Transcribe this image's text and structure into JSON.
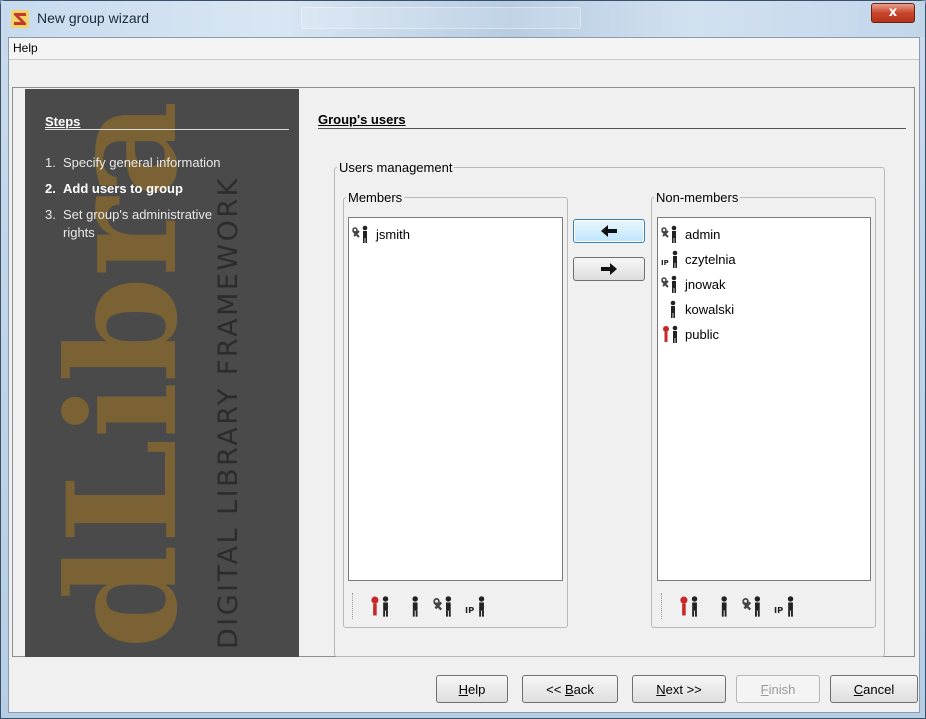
{
  "window": {
    "title": "New group wizard",
    "close_label": "x"
  },
  "menu": {
    "help": "Help"
  },
  "steps": {
    "title": "Steps",
    "items": [
      {
        "num": "1.",
        "label": "Specify general information",
        "active": false
      },
      {
        "num": "2.",
        "label": "Add users to group",
        "active": true
      },
      {
        "num": "3.",
        "label": "Set group's administrative",
        "label2": "rights",
        "active": false
      }
    ],
    "watermark_text": "DIGITAL LIBRARY FRAMEWORK",
    "logo_text": "dLibra"
  },
  "content": {
    "section_title": "Group's users",
    "users_management": "Users management",
    "members_legend": "Members",
    "nonmembers_legend": "Non-members",
    "members": [
      {
        "name": "jsmith",
        "icon": "admin-user-icon"
      }
    ],
    "nonmembers": [
      {
        "name": "admin",
        "icon": "admin-user-icon"
      },
      {
        "name": "czytelnia",
        "icon": "ip-user-icon"
      },
      {
        "name": "jnowak",
        "icon": "admin-user-icon"
      },
      {
        "name": "kowalski",
        "icon": "user-icon"
      },
      {
        "name": "public",
        "icon": "public-user-icon"
      }
    ],
    "filter_icons": [
      "public-user-icon",
      "user-icon",
      "admin-user-icon",
      "ip-user-icon"
    ]
  },
  "buttons": {
    "help": {
      "acc": "H",
      "rest": "elp"
    },
    "back": {
      "pre": "<< ",
      "acc": "B",
      "rest": "ack"
    },
    "next": {
      "acc": "N",
      "rest": "ext >>"
    },
    "finish": {
      "acc": "F",
      "rest": "inish"
    },
    "cancel": {
      "acc": "C",
      "rest": "ancel"
    }
  },
  "colors": {
    "steps_panel_bg": "#4a4a4a",
    "logo_color": "#8a6a2e",
    "focus_blue": "#3c7fb1"
  }
}
